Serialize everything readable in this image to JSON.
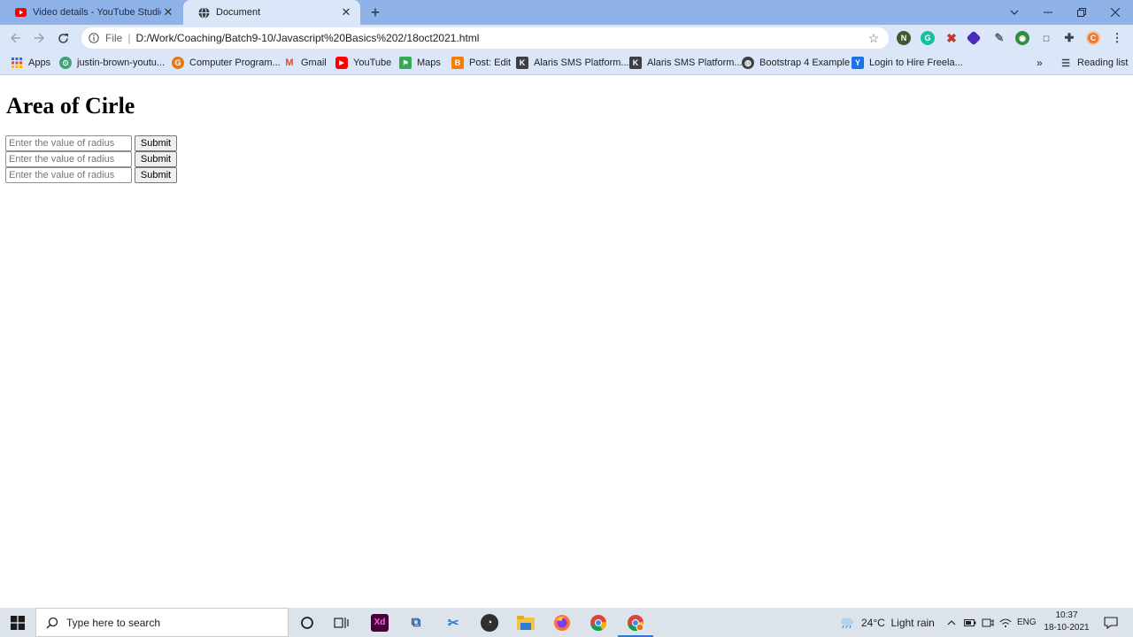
{
  "browser": {
    "tabs": [
      {
        "title": "Video details - YouTube Studio",
        "favicon": "youtube-icon",
        "active": false
      },
      {
        "title": "Document",
        "favicon": "globe-icon",
        "active": true
      }
    ],
    "new_tab_symbol": "+",
    "address": {
      "scheme_label": "File",
      "url": "D:/Work/Coaching/Batch9-10/Javascript%20Basics%202/18oct2021.html"
    },
    "extensions": [
      "extension-n-icon",
      "grammarly-icon",
      "extension-tools-icon",
      "extension-diamond-icon",
      "eyedropper-icon",
      "extension-globe-icon",
      "screenshot-icon",
      "extensions-puzzle-icon",
      "profile-avatar-icon",
      "more-menu-icon"
    ],
    "bookmarks": [
      {
        "label": "Apps",
        "icon": "apps-grid-icon"
      },
      {
        "label": "justin-brown-youtu...",
        "icon": "bookmark-circle-icon"
      },
      {
        "label": "Computer Program...",
        "icon": "bookmark-geek-icon"
      },
      {
        "label": "Gmail",
        "icon": "gmail-icon"
      },
      {
        "label": "YouTube",
        "icon": "youtube-icon"
      },
      {
        "label": "Maps",
        "icon": "maps-icon"
      },
      {
        "label": "Post: Edit",
        "icon": "blogger-icon"
      },
      {
        "label": "Alaris SMS Platform...",
        "icon": "alaris-icon"
      },
      {
        "label": "Alaris SMS Platform...",
        "icon": "alaris-icon"
      },
      {
        "label": "Bootstrap 4 Example",
        "icon": "globe-icon"
      },
      {
        "label": "Login to Hire Freela...",
        "icon": "freelancer-icon"
      }
    ],
    "bookmarks_overflow": "»",
    "reading_list": "Reading list"
  },
  "page": {
    "heading": "Area of Cirle",
    "rows": [
      {
        "placeholder": "Enter the value of radius",
        "button": "Submit"
      },
      {
        "placeholder": "Enter the value of radius",
        "button": "Submit"
      },
      {
        "placeholder": "Enter the value of radius",
        "button": "Submit"
      }
    ]
  },
  "taskbar": {
    "search_placeholder": "Type here to search",
    "weather": "24°C  Light rain",
    "language": "ENG",
    "time": "10:37",
    "date": "18-10-2021"
  },
  "colors": {
    "tabstrip": "#8fb2e8",
    "toolbar": "#dbe6f8",
    "taskbar": "#dde3ea",
    "taskbar_active_indicator": "#2b7bd6"
  }
}
